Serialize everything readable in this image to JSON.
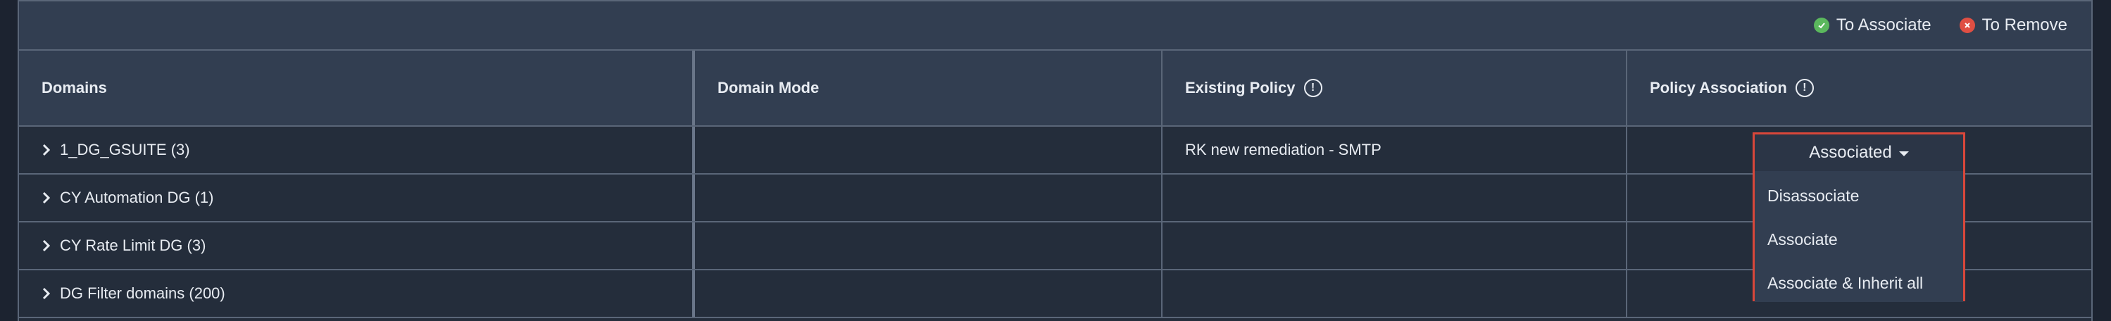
{
  "legend": {
    "to_associate": "To Associate",
    "to_remove": "To Remove"
  },
  "columns": [
    "Domains",
    "Domain Mode",
    "Existing Policy",
    "Policy Association"
  ],
  "rows": [
    {
      "domain": "1_DG_GSUITE (3)",
      "mode": "",
      "policy": "RK new remediation - SMTP"
    },
    {
      "domain": "CY Automation DG (1)",
      "mode": "",
      "policy": ""
    },
    {
      "domain": "CY Rate Limit DG (3)",
      "mode": "",
      "policy": ""
    },
    {
      "domain": "DG Filter domains (200)",
      "mode": "",
      "policy": ""
    }
  ],
  "association": {
    "selected": "Associated",
    "options": [
      "Disassociate",
      "Associate",
      "Associate & Inherit all"
    ]
  },
  "colors": {
    "green": "#5bb85d",
    "red": "#e04f43",
    "highlight": "#d9473a"
  }
}
